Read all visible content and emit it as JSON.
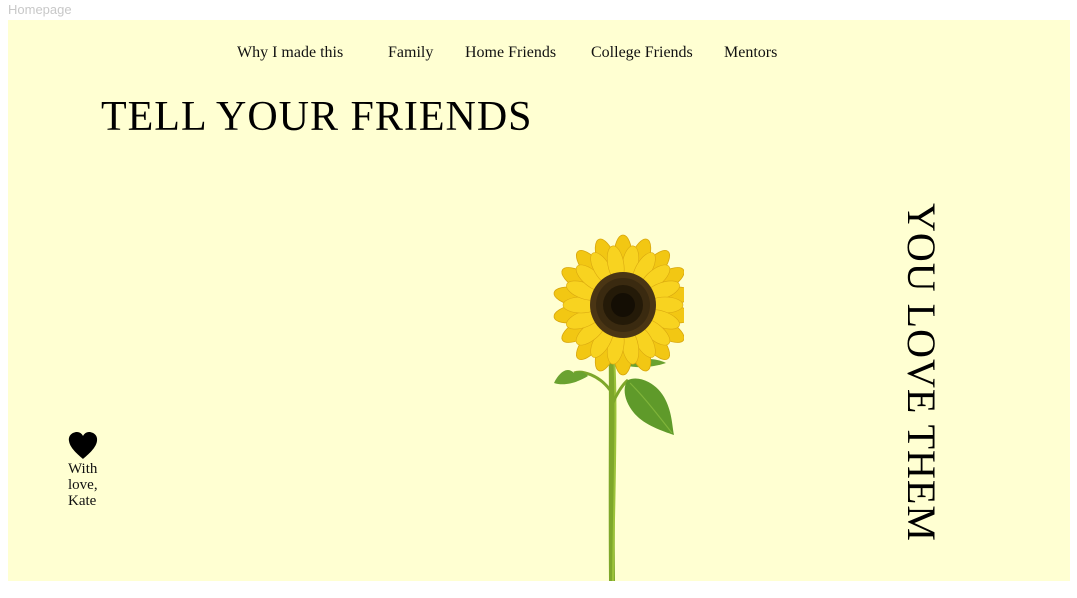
{
  "frame": {
    "label": "Homepage"
  },
  "nav": [
    {
      "label": "Why I made this"
    },
    {
      "label": "Family"
    },
    {
      "label": "Home Friends"
    },
    {
      "label": "College Friends"
    },
    {
      "label": "Mentors"
    }
  ],
  "hero": {
    "headline": "TELL YOUR FRIENDS",
    "vertical_text": "YOU LOVE THEM"
  },
  "signoff": {
    "line1": "With",
    "line2": "love,",
    "line3": "Kate"
  },
  "colors": {
    "background": "#ffffd2",
    "text": "#000000"
  },
  "icons": {
    "heart": "heart-icon",
    "sunflower": "sunflower-image"
  }
}
